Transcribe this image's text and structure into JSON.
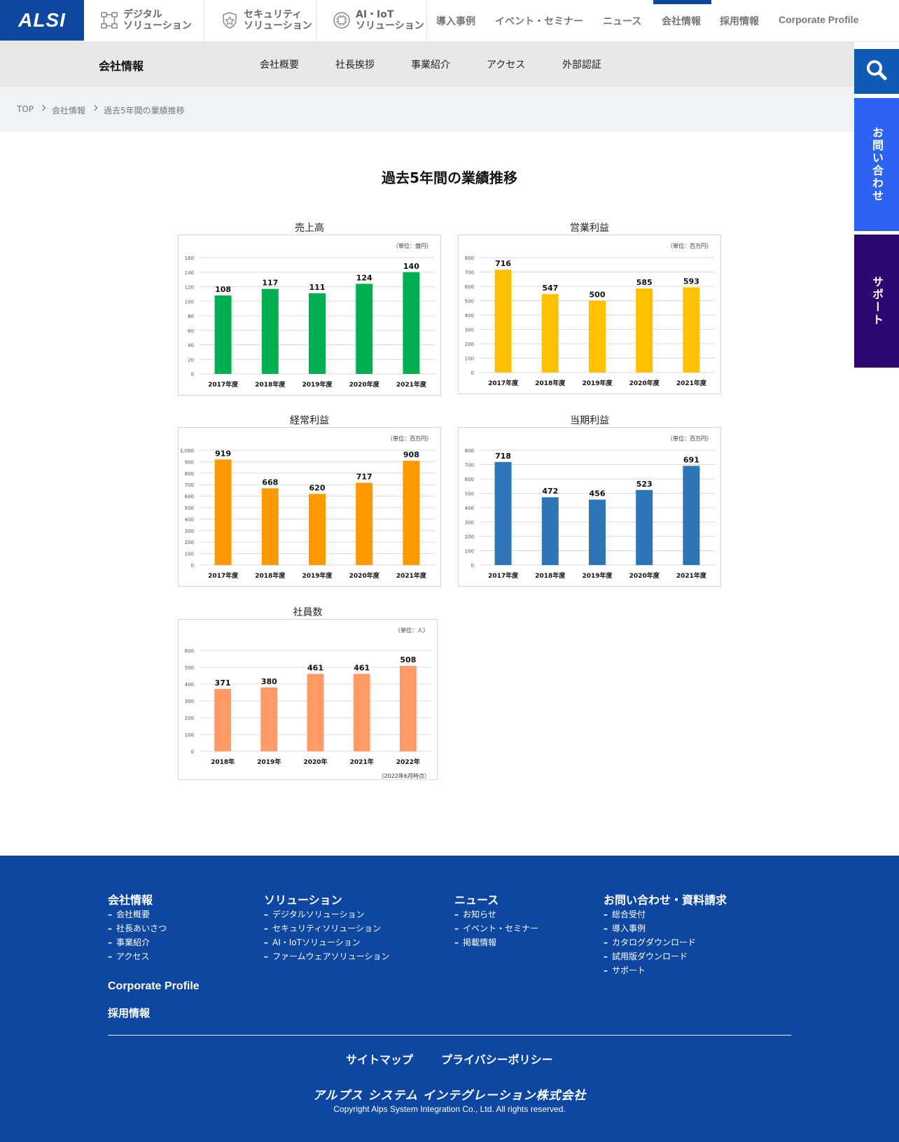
{
  "header": {
    "logo": "ALSI",
    "solutions": [
      {
        "label": "デジタル\nソリューション",
        "icon": "network-icon"
      },
      {
        "label": "セキュリティ\nソリューション",
        "icon": "shield-icon"
      },
      {
        "label": "AI・IoT\nソリューション",
        "icon": "ai-chip-icon"
      }
    ],
    "nav": [
      "導入事例",
      "イベント・セミナー",
      "ニュース",
      "会社情報",
      "採用情報",
      "Corporate Profile"
    ],
    "active_nav": "会社情報"
  },
  "subnav": {
    "title": "会社情報",
    "items": [
      "会社概要",
      "社長挨拶",
      "事業紹介",
      "アクセス",
      "外部認証"
    ]
  },
  "side": {
    "search_icon": "search-icon",
    "contact_label": "お問い合わせ",
    "support_label": "サポート"
  },
  "breadcrumb": [
    "TOP",
    "会社情報",
    "過去5年間の業績推移"
  ],
  "page_title": "過去5年間の業績推移",
  "chart_data": [
    {
      "type": "bar",
      "title": "売上高",
      "unit": "（単位：億円）",
      "categories": [
        "2017年度",
        "2018年度",
        "2019年度",
        "2020年度",
        "2021年度"
      ],
      "values": [
        108,
        117,
        111,
        124,
        140
      ],
      "ylim": [
        0,
        160
      ],
      "yticks": [
        "0",
        "20",
        "40",
        "60",
        "80",
        "100",
        "120",
        "140",
        "160"
      ],
      "color": "#00b050",
      "grid": true,
      "note": ""
    },
    {
      "type": "bar",
      "title": "営業利益",
      "unit": "（単位：百万円）",
      "categories": [
        "2017年度",
        "2018年度",
        "2019年度",
        "2020年度",
        "2021年度"
      ],
      "values": [
        716,
        547,
        500,
        585,
        593
      ],
      "ylim": [
        0,
        800
      ],
      "yticks": [
        "0",
        "100",
        "200",
        "300",
        "400",
        "500",
        "600",
        "700",
        "800"
      ],
      "color": "#ffc000",
      "grid": true,
      "note": ""
    },
    {
      "type": "bar",
      "title": "経常利益",
      "unit": "（単位：百万円）",
      "categories": [
        "2017年度",
        "2018年度",
        "2019年度",
        "2020年度",
        "2021年度"
      ],
      "values": [
        919,
        668,
        620,
        717,
        908
      ],
      "ylim": [
        0,
        1000
      ],
      "yticks": [
        "0",
        "100",
        "200",
        "300",
        "400",
        "500",
        "600",
        "700",
        "800",
        "900",
        "1,000"
      ],
      "color": "#ff9900",
      "grid": true,
      "note": ""
    },
    {
      "type": "bar",
      "title": "当期利益",
      "unit": "（単位：百万円）",
      "categories": [
        "2017年度",
        "2018年度",
        "2019年度",
        "2020年度",
        "2021年度"
      ],
      "values": [
        718,
        472,
        456,
        523,
        691
      ],
      "ylim": [
        0,
        800
      ],
      "yticks": [
        "0",
        "100",
        "200",
        "300",
        "400",
        "500",
        "600",
        "700",
        "800"
      ],
      "color": "#2e75b6",
      "grid": true,
      "note": ""
    },
    {
      "type": "bar",
      "title": "社員数",
      "unit": "（単位：人）",
      "categories": [
        "2018年",
        "2019年",
        "2020年",
        "2021年",
        "2022年"
      ],
      "values": [
        371,
        380,
        461,
        461,
        508
      ],
      "ylim": [
        0,
        600
      ],
      "yticks": [
        "0",
        "100",
        "200",
        "300",
        "400",
        "500",
        "600"
      ],
      "color": "#ff9966",
      "grid": true,
      "note": "（2022年6月時点）"
    }
  ],
  "footer": {
    "columns": [
      {
        "heading": "会社情報",
        "links": [
          "会社概要",
          "社長あいさつ",
          "事業紹介",
          "アクセス"
        ]
      },
      {
        "heading": "ソリューション",
        "links": [
          "デジタルソリューション",
          "セキュリティソリューション",
          "AI・IoTソリューション",
          "ファームウェアソリューション"
        ]
      },
      {
        "heading": "ニュース",
        "links": [
          "お知らせ",
          "イベント・セミナー",
          "掲載情報"
        ]
      },
      {
        "heading": "お問い合わせ・資料請求",
        "links": [
          "総合受付",
          "導入事例",
          "カタログダウンロード",
          "試用版ダウンロード",
          "サポート"
        ]
      }
    ],
    "corporate_profile": "Corporate Profile",
    "recruit": "採用情報",
    "bottom_links": [
      "サイトマップ",
      "プライバシーポリシー"
    ],
    "company_name": "アルプス システム インテグレーション株式会社",
    "copyright": "Copyright Alps System Integration Co., Ltd. All rights reserved."
  }
}
